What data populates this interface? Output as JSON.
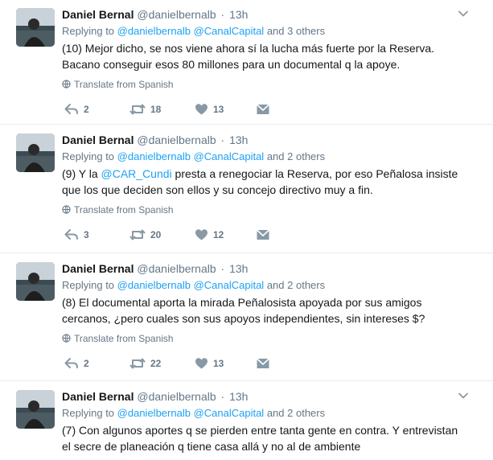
{
  "tweets": [
    {
      "name": "Daniel Bernal",
      "handle": "@danielbernalb",
      "separator": "·",
      "time": "13h",
      "replying_prefix": "Replying to",
      "reply_to_1": "@danielbernalb",
      "reply_to_2": "@CanalCapital",
      "reply_suffix": "and 3 others",
      "text_1": "(10) Mejor dicho, se nos viene ahora sí la lucha más fuerte por la Reserva.",
      "text_2": "Bacano conseguir esos 80 millones para un documental q la apoye.",
      "translate": "Translate from Spanish",
      "replies": "2",
      "retweets": "18",
      "likes": "13"
    },
    {
      "name": "Daniel Bernal",
      "handle": "@danielbernalb",
      "separator": "·",
      "time": "13h",
      "replying_prefix": "Replying to",
      "reply_to_1": "@danielbernalb",
      "reply_to_2": "@CanalCapital",
      "reply_suffix": "and 2 others",
      "text_a": "(9) Y la ",
      "text_mention": "@CAR_Cundi",
      "text_b": " presta a renegociar la Reserva, por eso Peñalosa insiste",
      "text_2": "que los que deciden son ellos y su concejo directivo muy a fin.",
      "translate": "Translate from Spanish",
      "replies": "3",
      "retweets": "20",
      "likes": "12"
    },
    {
      "name": "Daniel Bernal",
      "handle": "@danielbernalb",
      "separator": "·",
      "time": "13h",
      "replying_prefix": "Replying to",
      "reply_to_1": "@danielbernalb",
      "reply_to_2": "@CanalCapital",
      "reply_suffix": "and 2 others",
      "text_1": "(8) El documental aporta la mirada Peñalosista apoyada por sus amigos",
      "text_2": "cercanos, ¿pero cuales son sus apoyos independientes, sin intereses $?",
      "translate": "Translate from Spanish",
      "replies": "2",
      "retweets": "22",
      "likes": "13"
    },
    {
      "name": "Daniel Bernal",
      "handle": "@danielbernalb",
      "separator": "·",
      "time": "13h",
      "replying_prefix": "Replying to",
      "reply_to_1": "@danielbernalb",
      "reply_to_2": "@CanalCapital",
      "reply_suffix": "and 2 others",
      "text_1": "(7) Con algunos aportes q se pierden entre tanta gente en contra. Y entrevistan",
      "text_2": "el secre de planeación q tiene casa allá y no al de ambiente"
    }
  ],
  "colors": {
    "link": "#1da1f2",
    "muted": "#657786",
    "text": "#14171a",
    "divider": "#e6ecf0"
  },
  "icons": [
    "reply-icon",
    "retweet-icon",
    "like-icon",
    "direct-message-icon",
    "caret-down-icon",
    "globe-icon"
  ]
}
